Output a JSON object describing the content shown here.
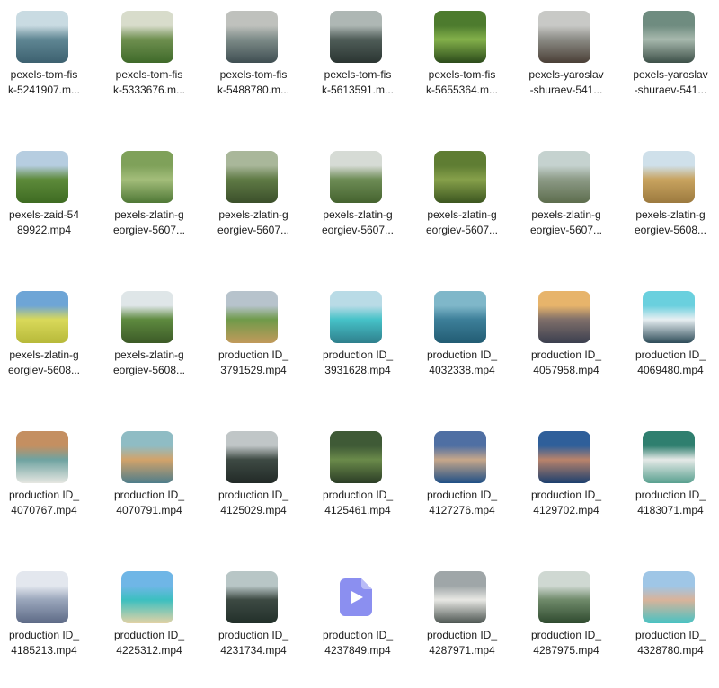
{
  "files": [
    {
      "name": "pexels-tom-fis\nk-5241907.m...",
      "thumbnail": "lake-with-forest-shore",
      "colors": [
        "#c9dbe2",
        "#5f8693",
        "#3d6170"
      ]
    },
    {
      "name": "pexels-tom-fis\nk-5333676.m...",
      "thumbnail": "green-field-sunlight",
      "colors": [
        "#d8dccb",
        "#6e8f4f",
        "#3f6a2a"
      ]
    },
    {
      "name": "pexels-tom-fis\nk-5488780.m...",
      "thumbnail": "misty-town-hills",
      "colors": [
        "#bfc1bd",
        "#7d8b88",
        "#3f4e52"
      ]
    },
    {
      "name": "pexels-tom-fis\nk-5613591.m...",
      "thumbnail": "dark-lake-reflection",
      "colors": [
        "#aeb7b4",
        "#4f5d58",
        "#2b3532"
      ]
    },
    {
      "name": "pexels-tom-fis\nk-5655364.m...",
      "thumbnail": "green-forest-canopy",
      "colors": [
        "#4d7b2e",
        "#83b04a",
        "#2c4b1b"
      ]
    },
    {
      "name": "pexels-yaroslav\n-shuraev-541...",
      "thumbnail": "misty-cliff",
      "colors": [
        "#c8c9c6",
        "#8b8b85",
        "#4a3f36"
      ]
    },
    {
      "name": "pexels-yaroslav\n-shuraev-541...",
      "thumbnail": "river-rocks",
      "colors": [
        "#6f8c80",
        "#a7b8ad",
        "#3d5048"
      ]
    },
    {
      "name": "pexels-zaid-54\n89922.mp4",
      "thumbnail": "tree-in-meadow",
      "colors": [
        "#b6cde0",
        "#5d8a3a",
        "#3e6b22"
      ]
    },
    {
      "name": "pexels-zlatin-g\neorgiev-5607...",
      "thumbnail": "aerial-green-field",
      "colors": [
        "#7fa15a",
        "#a3bd7a",
        "#4f7836"
      ]
    },
    {
      "name": "pexels-zlatin-g\neorgiev-5607...",
      "thumbnail": "canyon-forest",
      "colors": [
        "#a9b79a",
        "#5f7a45",
        "#3b4f2b"
      ]
    },
    {
      "name": "pexels-zlatin-g\neorgiev-5607...",
      "thumbnail": "hazy-forest-hills",
      "colors": [
        "#d6dbd5",
        "#6d8c55",
        "#45632f"
      ]
    },
    {
      "name": "pexels-zlatin-g\neorgiev-5607...",
      "thumbnail": "dense-forest",
      "colors": [
        "#5f7d33",
        "#86a04a",
        "#3c5620"
      ]
    },
    {
      "name": "pexels-zlatin-g\neorgiev-5607...",
      "thumbnail": "rocky-mountains",
      "colors": [
        "#c5d2cf",
        "#8c9a86",
        "#5d6d4d"
      ]
    },
    {
      "name": "pexels-zlatin-g\neorgiev-5608...",
      "thumbnail": "golden-wheat-field",
      "colors": [
        "#cfe0ea",
        "#c8a35f",
        "#9c7a3f"
      ]
    },
    {
      "name": "pexels-zlatin-g\neorgiev-5608...",
      "thumbnail": "yellow-rapeseed-field",
      "colors": [
        "#6ea5d6",
        "#d9d95a",
        "#b7b93a"
      ]
    },
    {
      "name": "pexels-zlatin-g\neorgiev-5608...",
      "thumbnail": "green-mountain-cliffs",
      "colors": [
        "#dfe6e8",
        "#5e8a3f",
        "#3c5a27"
      ]
    },
    {
      "name": "production ID_\n3791529.mp4",
      "thumbnail": "meadow-under-clouds",
      "colors": [
        "#b7c3cc",
        "#6f9a4a",
        "#c29a5b"
      ]
    },
    {
      "name": "production ID_\n3931628.mp4",
      "thumbnail": "turquoise-lagoon",
      "colors": [
        "#b9dbe6",
        "#46c2c8",
        "#2f7f8c"
      ]
    },
    {
      "name": "production ID_\n4032338.mp4",
      "thumbnail": "blue-sea-clouds",
      "colors": [
        "#7fb7c9",
        "#3d7f99",
        "#225c73"
      ]
    },
    {
      "name": "production ID_\n4057958.mp4",
      "thumbnail": "sunset-over-sea",
      "colors": [
        "#e7b46b",
        "#7f6f6a",
        "#3b3f4f"
      ]
    },
    {
      "name": "production ID_\n4069480.mp4",
      "thumbnail": "pool-villa-aerial",
      "colors": [
        "#6ad0de",
        "#e7eff2",
        "#2d4b58"
      ]
    },
    {
      "name": "production ID_\n4070767.mp4",
      "thumbnail": "rocky-coast-waves",
      "colors": [
        "#c48f61",
        "#6fa3a1",
        "#e6e7e2"
      ]
    },
    {
      "name": "production ID_\n4070791.mp4",
      "thumbnail": "coastal-cliffs",
      "colors": [
        "#8fbcc4",
        "#d2a36a",
        "#4f7d8a"
      ]
    },
    {
      "name": "production ID_\n4125029.mp4",
      "thumbnail": "mountain-river-valley",
      "colors": [
        "#c0c6c7",
        "#3e4a44",
        "#222a27"
      ]
    },
    {
      "name": "production ID_\n4125461.mp4",
      "thumbnail": "farmland-road-aerial",
      "colors": [
        "#3f5a36",
        "#6a8a4a",
        "#2b3d26"
      ]
    },
    {
      "name": "production ID_\n4127276.mp4",
      "thumbnail": "coastal-town-sea",
      "colors": [
        "#4f6fa3",
        "#c7a78a",
        "#1f4f86"
      ]
    },
    {
      "name": "production ID_\n4129702.mp4",
      "thumbnail": "old-town-peninsula",
      "colors": [
        "#2f5f9a",
        "#b9836b",
        "#1c3f6e"
      ]
    },
    {
      "name": "production ID_\n4183071.mp4",
      "thumbnail": "surf-foam-beach",
      "colors": [
        "#2f7f6f",
        "#e5e9e7",
        "#59a08f"
      ]
    },
    {
      "name": "production ID_\n4185213.mp4",
      "thumbnail": "snowy-mountains",
      "colors": [
        "#e3e7ee",
        "#9aa6bb",
        "#5d6a86"
      ]
    },
    {
      "name": "production ID_\n4225312.mp4",
      "thumbnail": "tropical-beach-coast",
      "colors": [
        "#6fb6e6",
        "#3cbfc0",
        "#e2d2a6"
      ]
    },
    {
      "name": "production ID_\n4231734.mp4",
      "thumbnail": "dark-volcanic-hills",
      "colors": [
        "#b8c6c6",
        "#3d4a43",
        "#22302a"
      ]
    },
    {
      "name": "production ID_\n4237849.mp4",
      "thumbnail": "generic-video-file-icon",
      "colors": [
        "#8b8ff0",
        "#ffffff",
        "#8b8ff0"
      ]
    },
    {
      "name": "production ID_\n4287971.mp4",
      "thumbnail": "clouds-over-mountains",
      "colors": [
        "#9fa6a8",
        "#e8e8e4",
        "#4d5652"
      ]
    },
    {
      "name": "production ID_\n4287975.mp4",
      "thumbnail": "foggy-forest",
      "colors": [
        "#cfd8d2",
        "#6f8a6a",
        "#2f4a2f"
      ]
    },
    {
      "name": "production ID_\n4328780.mp4",
      "thumbnail": "city-beach-waterfront",
      "colors": [
        "#9fc6e6",
        "#d9b39a",
        "#48c2c3"
      ]
    }
  ]
}
